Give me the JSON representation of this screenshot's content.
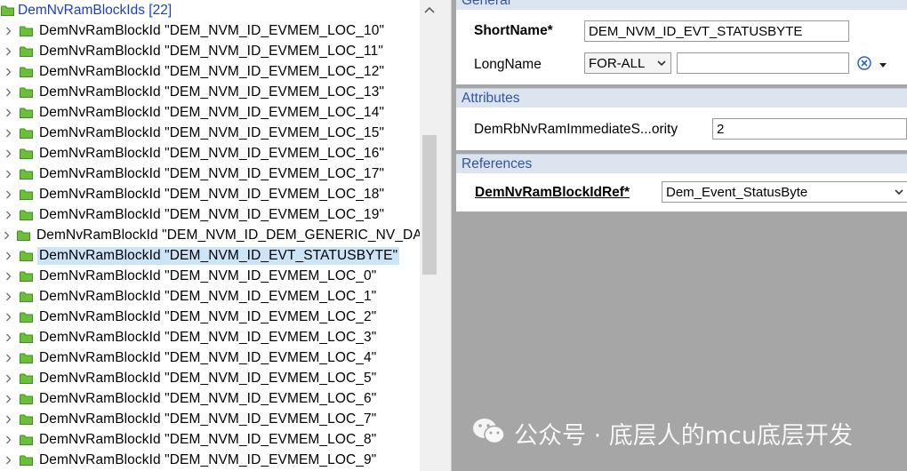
{
  "tree": {
    "root_label": "DemNvRamBlockIds [22]",
    "items": [
      {
        "label": "DemNvRamBlockId \"DEM_NVM_ID_EVMEM_LOC_10\""
      },
      {
        "label": "DemNvRamBlockId \"DEM_NVM_ID_EVMEM_LOC_11\""
      },
      {
        "label": "DemNvRamBlockId \"DEM_NVM_ID_EVMEM_LOC_12\""
      },
      {
        "label": "DemNvRamBlockId \"DEM_NVM_ID_EVMEM_LOC_13\""
      },
      {
        "label": "DemNvRamBlockId \"DEM_NVM_ID_EVMEM_LOC_14\""
      },
      {
        "label": "DemNvRamBlockId \"DEM_NVM_ID_EVMEM_LOC_15\""
      },
      {
        "label": "DemNvRamBlockId \"DEM_NVM_ID_EVMEM_LOC_16\""
      },
      {
        "label": "DemNvRamBlockId \"DEM_NVM_ID_EVMEM_LOC_17\""
      },
      {
        "label": "DemNvRamBlockId \"DEM_NVM_ID_EVMEM_LOC_18\""
      },
      {
        "label": "DemNvRamBlockId \"DEM_NVM_ID_EVMEM_LOC_19\""
      },
      {
        "label": "DemNvRamBlockId \"DEM_NVM_ID_DEM_GENERIC_NV_DATA"
      },
      {
        "label": "DemNvRamBlockId \"DEM_NVM_ID_EVT_STATUSBYTE\"",
        "selected": true
      },
      {
        "label": "DemNvRamBlockId \"DEM_NVM_ID_EVMEM_LOC_0\""
      },
      {
        "label": "DemNvRamBlockId \"DEM_NVM_ID_EVMEM_LOC_1\""
      },
      {
        "label": "DemNvRamBlockId \"DEM_NVM_ID_EVMEM_LOC_2\""
      },
      {
        "label": "DemNvRamBlockId \"DEM_NVM_ID_EVMEM_LOC_3\""
      },
      {
        "label": "DemNvRamBlockId \"DEM_NVM_ID_EVMEM_LOC_4\""
      },
      {
        "label": "DemNvRamBlockId \"DEM_NVM_ID_EVMEM_LOC_5\""
      },
      {
        "label": "DemNvRamBlockId \"DEM_NVM_ID_EVMEM_LOC_6\""
      },
      {
        "label": "DemNvRamBlockId \"DEM_NVM_ID_EVMEM_LOC_7\""
      },
      {
        "label": "DemNvRamBlockId \"DEM_NVM_ID_EVMEM_LOC_8\""
      },
      {
        "label": "DemNvRamBlockId \"DEM_NVM_ID_EVMEM_LOC_9\""
      }
    ]
  },
  "panel": {
    "general": {
      "header": "General",
      "shortname_label": "ShortName*",
      "shortname_value": "DEM_NVM_ID_EVT_STATUSBYTE",
      "longname_label": "LongName",
      "longname_lang": "FOR-ALL",
      "longname_value": ""
    },
    "attributes": {
      "header": "Attributes",
      "priority_label": "DemRbNvRamImmediateS...ority",
      "priority_value": "2"
    },
    "references": {
      "header": "References",
      "blockref_label": "DemNvRamBlockIdRef*",
      "blockref_value": "Dem_Event_StatusByte"
    }
  },
  "watermark": {
    "text": "公众号 · 底层人的mcu底层开发"
  },
  "colors": {
    "folder_green": "#6cbf3a",
    "selection": "#cce4f7",
    "section_header_bg": "#dbe4ef",
    "section_header_text": "#2f55a4",
    "panel_bg": "#a6a6a6"
  }
}
